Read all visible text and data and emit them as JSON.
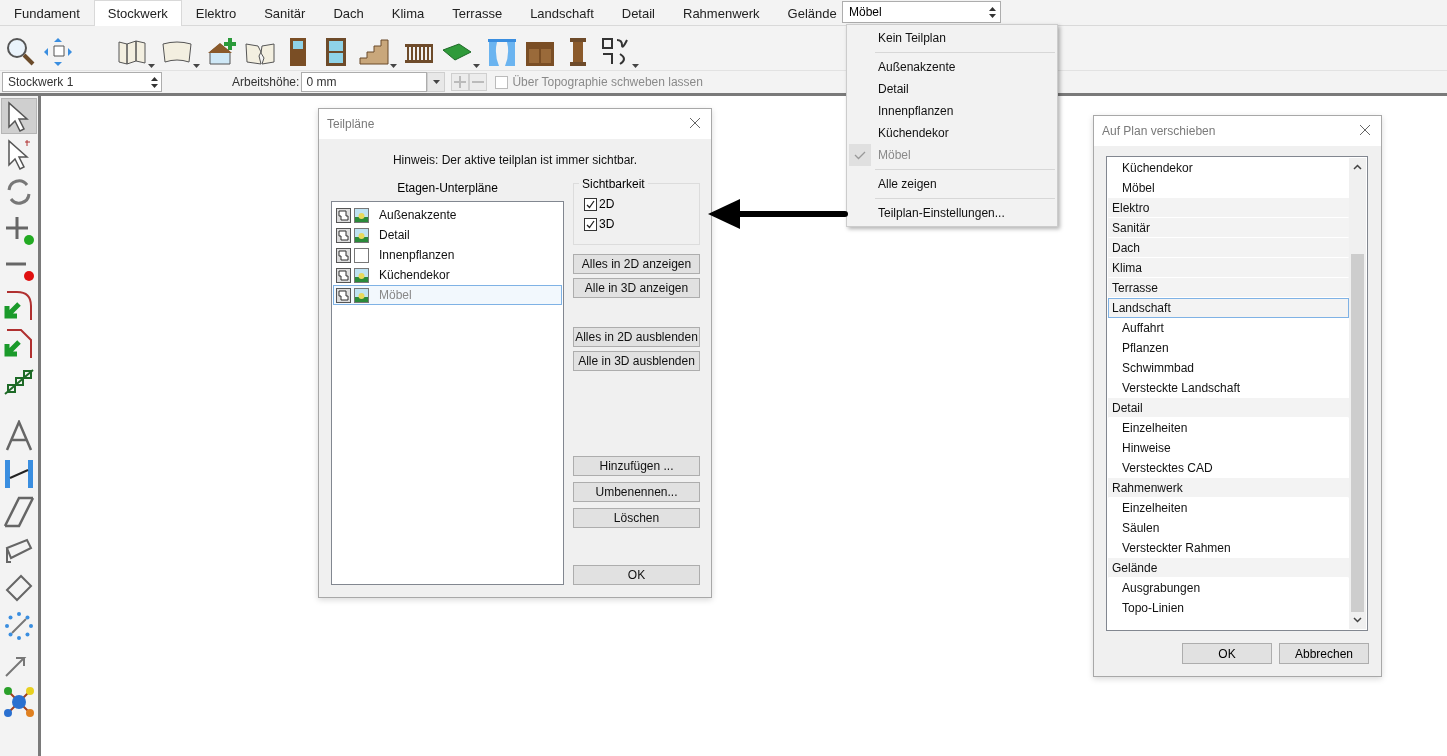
{
  "tabs": [
    {
      "label": "Fundament",
      "selected": false
    },
    {
      "label": "Stockwerk",
      "selected": true
    },
    {
      "label": "Elektro",
      "selected": false
    },
    {
      "label": "Sanitär",
      "selected": false
    },
    {
      "label": "Dach",
      "selected": false
    },
    {
      "label": "Klima",
      "selected": false
    },
    {
      "label": "Terrasse",
      "selected": false
    },
    {
      "label": "Landschaft",
      "selected": false
    },
    {
      "label": "Detail",
      "selected": false
    },
    {
      "label": "Rahmenwerk",
      "selected": false
    },
    {
      "label": "Gelände",
      "selected": false
    }
  ],
  "subplan_select": {
    "value": "Möbel"
  },
  "subplan_menu": {
    "groups": [
      [
        {
          "label": "Kein Teilplan",
          "checked": false
        }
      ],
      [
        {
          "label": "Außenakzente",
          "checked": false
        },
        {
          "label": "Detail",
          "checked": false
        },
        {
          "label": "Innenpflanzen",
          "checked": false
        },
        {
          "label": "Küchendekor",
          "checked": false
        },
        {
          "label": "Möbel",
          "checked": true
        }
      ],
      [
        {
          "label": "Alle zeigen",
          "checked": false
        }
      ],
      [
        {
          "label": "Teilplan-Einstellungen...",
          "checked": false
        }
      ]
    ]
  },
  "options_bar": {
    "floor": "Stockwerk 1",
    "height_label": "Arbeitshöhe:",
    "height_value": "0 mm",
    "float_label": "Über Topographie schweben lassen",
    "float_checked": false
  },
  "left_toolbar": [
    {
      "selected": true
    },
    {
      "selected": false
    },
    {
      "selected": false
    },
    {
      "selected": false
    },
    {
      "selected": false
    },
    {
      "selected": false
    },
    {
      "selected": false
    },
    {
      "selected": false
    },
    {
      "selected": false
    },
    {
      "selected": false
    },
    {
      "selected": false
    },
    {
      "selected": false
    },
    {
      "selected": false
    },
    {
      "selected": false
    },
    {
      "selected": false
    },
    {
      "selected": false
    }
  ],
  "layers_dialog": {
    "title": "Teilpläne",
    "hint": "Hinweis: Der aktive teilplan ist immer sichtbar.",
    "list_heading": "Etagen-Unterpläne",
    "layers": [
      {
        "name": "Außenakzente",
        "shown_3d": true,
        "selected": false
      },
      {
        "name": "Detail",
        "shown_3d": true,
        "selected": false
      },
      {
        "name": "Innenpflanzen",
        "shown_3d": false,
        "selected": false
      },
      {
        "name": "Küchendekor",
        "shown_3d": true,
        "selected": false
      },
      {
        "name": "Möbel",
        "shown_3d": true,
        "selected": true
      }
    ],
    "visibility": {
      "title": "Sichtbarkeit",
      "options": [
        {
          "label": "2D",
          "checked": true
        },
        {
          "label": "3D",
          "checked": true
        }
      ]
    },
    "button_groups": [
      [
        "Alles in 2D anzeigen",
        "Alle in 3D anzeigen"
      ],
      [
        "Alles in 2D ausblenden",
        "Alle in 3D ausblenden"
      ],
      [
        "Hinzufügen ...",
        "Umbenennen...",
        "Löschen"
      ]
    ],
    "ok": "OK"
  },
  "move_dialog": {
    "title": "Auf Plan verschieben",
    "tree": [
      {
        "children": [
          {
            "label": "Küchendekor",
            "selected": false
          },
          {
            "label": "Möbel",
            "selected": false
          }
        ]
      },
      {
        "label": "Elektro",
        "selected": false
      },
      {
        "label": "Sanitär",
        "selected": false
      },
      {
        "label": "Dach",
        "selected": false
      },
      {
        "label": "Klima",
        "selected": false
      },
      {
        "label": "Terrasse",
        "selected": false
      },
      {
        "label": "Landschaft",
        "selected": true,
        "children": [
          {
            "label": "Auffahrt",
            "selected": false
          },
          {
            "label": "Pflanzen",
            "selected": false
          },
          {
            "label": "Schwimmbad",
            "selected": false
          },
          {
            "label": "Versteckte Landschaft",
            "selected": false
          }
        ]
      },
      {
        "label": "Detail",
        "selected": false,
        "children": [
          {
            "label": "Einzelheiten",
            "selected": false
          },
          {
            "label": "Hinweise",
            "selected": false
          },
          {
            "label": "Verstecktes CAD",
            "selected": false
          }
        ]
      },
      {
        "label": "Rahmenwerk",
        "selected": false,
        "children": [
          {
            "label": "Einzelheiten",
            "selected": false
          },
          {
            "label": "Säulen",
            "selected": false
          },
          {
            "label": "Versteckter Rahmen",
            "selected": false
          }
        ]
      },
      {
        "label": "Gelände",
        "selected": false,
        "children": [
          {
            "label": "Ausgrabungen",
            "selected": false
          },
          {
            "label": "Topo-Linien",
            "selected": false
          }
        ]
      }
    ],
    "buttons": [
      "OK",
      "Abbrechen"
    ]
  }
}
